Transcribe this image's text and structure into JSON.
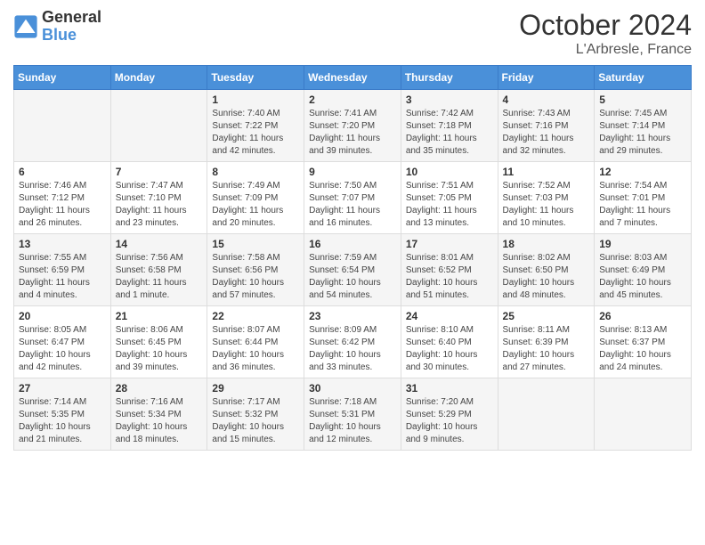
{
  "header": {
    "logo_general": "General",
    "logo_blue": "Blue",
    "month_title": "October 2024",
    "location": "L'Arbresle, France"
  },
  "days_of_week": [
    "Sunday",
    "Monday",
    "Tuesday",
    "Wednesday",
    "Thursday",
    "Friday",
    "Saturday"
  ],
  "weeks": [
    [
      {
        "day": "",
        "info": ""
      },
      {
        "day": "",
        "info": ""
      },
      {
        "day": "1",
        "info": "Sunrise: 7:40 AM\nSunset: 7:22 PM\nDaylight: 11 hours and 42 minutes."
      },
      {
        "day": "2",
        "info": "Sunrise: 7:41 AM\nSunset: 7:20 PM\nDaylight: 11 hours and 39 minutes."
      },
      {
        "day": "3",
        "info": "Sunrise: 7:42 AM\nSunset: 7:18 PM\nDaylight: 11 hours and 35 minutes."
      },
      {
        "day": "4",
        "info": "Sunrise: 7:43 AM\nSunset: 7:16 PM\nDaylight: 11 hours and 32 minutes."
      },
      {
        "day": "5",
        "info": "Sunrise: 7:45 AM\nSunset: 7:14 PM\nDaylight: 11 hours and 29 minutes."
      }
    ],
    [
      {
        "day": "6",
        "info": "Sunrise: 7:46 AM\nSunset: 7:12 PM\nDaylight: 11 hours and 26 minutes."
      },
      {
        "day": "7",
        "info": "Sunrise: 7:47 AM\nSunset: 7:10 PM\nDaylight: 11 hours and 23 minutes."
      },
      {
        "day": "8",
        "info": "Sunrise: 7:49 AM\nSunset: 7:09 PM\nDaylight: 11 hours and 20 minutes."
      },
      {
        "day": "9",
        "info": "Sunrise: 7:50 AM\nSunset: 7:07 PM\nDaylight: 11 hours and 16 minutes."
      },
      {
        "day": "10",
        "info": "Sunrise: 7:51 AM\nSunset: 7:05 PM\nDaylight: 11 hours and 13 minutes."
      },
      {
        "day": "11",
        "info": "Sunrise: 7:52 AM\nSunset: 7:03 PM\nDaylight: 11 hours and 10 minutes."
      },
      {
        "day": "12",
        "info": "Sunrise: 7:54 AM\nSunset: 7:01 PM\nDaylight: 11 hours and 7 minutes."
      }
    ],
    [
      {
        "day": "13",
        "info": "Sunrise: 7:55 AM\nSunset: 6:59 PM\nDaylight: 11 hours and 4 minutes."
      },
      {
        "day": "14",
        "info": "Sunrise: 7:56 AM\nSunset: 6:58 PM\nDaylight: 11 hours and 1 minute."
      },
      {
        "day": "15",
        "info": "Sunrise: 7:58 AM\nSunset: 6:56 PM\nDaylight: 10 hours and 57 minutes."
      },
      {
        "day": "16",
        "info": "Sunrise: 7:59 AM\nSunset: 6:54 PM\nDaylight: 10 hours and 54 minutes."
      },
      {
        "day": "17",
        "info": "Sunrise: 8:01 AM\nSunset: 6:52 PM\nDaylight: 10 hours and 51 minutes."
      },
      {
        "day": "18",
        "info": "Sunrise: 8:02 AM\nSunset: 6:50 PM\nDaylight: 10 hours and 48 minutes."
      },
      {
        "day": "19",
        "info": "Sunrise: 8:03 AM\nSunset: 6:49 PM\nDaylight: 10 hours and 45 minutes."
      }
    ],
    [
      {
        "day": "20",
        "info": "Sunrise: 8:05 AM\nSunset: 6:47 PM\nDaylight: 10 hours and 42 minutes."
      },
      {
        "day": "21",
        "info": "Sunrise: 8:06 AM\nSunset: 6:45 PM\nDaylight: 10 hours and 39 minutes."
      },
      {
        "day": "22",
        "info": "Sunrise: 8:07 AM\nSunset: 6:44 PM\nDaylight: 10 hours and 36 minutes."
      },
      {
        "day": "23",
        "info": "Sunrise: 8:09 AM\nSunset: 6:42 PM\nDaylight: 10 hours and 33 minutes."
      },
      {
        "day": "24",
        "info": "Sunrise: 8:10 AM\nSunset: 6:40 PM\nDaylight: 10 hours and 30 minutes."
      },
      {
        "day": "25",
        "info": "Sunrise: 8:11 AM\nSunset: 6:39 PM\nDaylight: 10 hours and 27 minutes."
      },
      {
        "day": "26",
        "info": "Sunrise: 8:13 AM\nSunset: 6:37 PM\nDaylight: 10 hours and 24 minutes."
      }
    ],
    [
      {
        "day": "27",
        "info": "Sunrise: 7:14 AM\nSunset: 5:35 PM\nDaylight: 10 hours and 21 minutes."
      },
      {
        "day": "28",
        "info": "Sunrise: 7:16 AM\nSunset: 5:34 PM\nDaylight: 10 hours and 18 minutes."
      },
      {
        "day": "29",
        "info": "Sunrise: 7:17 AM\nSunset: 5:32 PM\nDaylight: 10 hours and 15 minutes."
      },
      {
        "day": "30",
        "info": "Sunrise: 7:18 AM\nSunset: 5:31 PM\nDaylight: 10 hours and 12 minutes."
      },
      {
        "day": "31",
        "info": "Sunrise: 7:20 AM\nSunset: 5:29 PM\nDaylight: 10 hours and 9 minutes."
      },
      {
        "day": "",
        "info": ""
      },
      {
        "day": "",
        "info": ""
      }
    ]
  ]
}
